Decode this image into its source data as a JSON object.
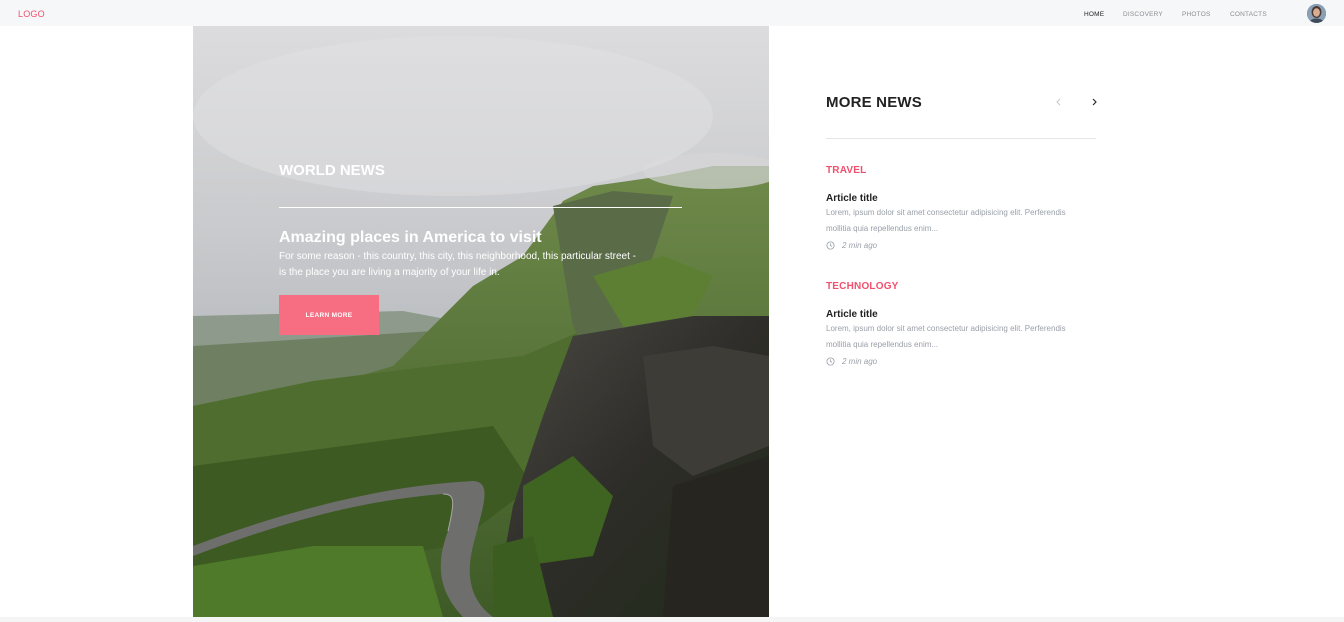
{
  "header": {
    "logo": "LOGO",
    "nav": [
      {
        "label": "HOME",
        "active": true
      },
      {
        "label": "DISCOVERY",
        "active": false
      },
      {
        "label": "PHOTOS",
        "active": false
      },
      {
        "label": "CONTACTS",
        "active": false
      }
    ]
  },
  "hero": {
    "kicker": "WORLD NEWS",
    "title": "Amazing places in America to visit",
    "text": "For some reason - this country, this city, this neighborhood, this particular street - is the place you are living a majority of your life in.",
    "button_label": "LEARN MORE"
  },
  "sidebar": {
    "title": "MORE NEWS",
    "articles": [
      {
        "category": "TRAVEL",
        "title": "Article title",
        "text": "Lorem, ipsum dolor sit amet consectetur adipisicing elit. Perferendis mollitia quia repellendus enim...",
        "time": "2 min ago"
      },
      {
        "category": "TECHNOLOGY",
        "title": "Article title",
        "text": "Lorem, ipsum dolor sit amet consectetur adipisicing elit. Perferendis mollitia quia repellendus enim...",
        "time": "2 min ago"
      }
    ]
  },
  "colors": {
    "accent": "#f0506e",
    "button": "#f76e82",
    "muted": "#9aa0a8",
    "dark": "#222222"
  },
  "icons": {
    "prev": "chevron-left-icon",
    "next": "chevron-right-icon",
    "clock": "clock-icon"
  }
}
